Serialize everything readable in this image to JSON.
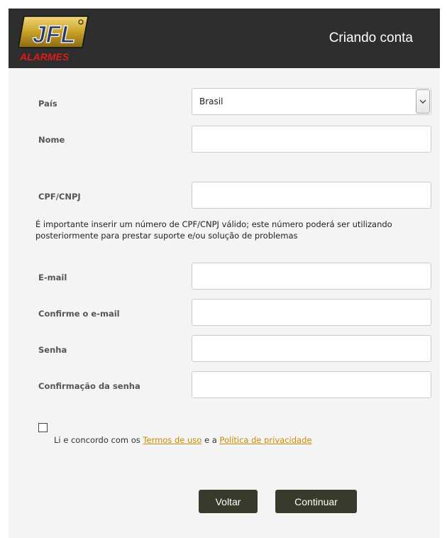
{
  "header": {
    "brand_top": "JFL",
    "brand_sub": "ALARMES",
    "title": "Criando conta"
  },
  "form": {
    "country": {
      "label": "País",
      "value": "Brasil"
    },
    "name": {
      "label": "Nome",
      "value": ""
    },
    "cpf": {
      "label": "CPF/CNPJ",
      "value": ""
    },
    "info": "É importante inserir um número de CPF/CNPJ válido; este número poderá ser utilizando posteriormente para prestar suporte e/ou solução de problemas",
    "email": {
      "label": "E-mail",
      "value": ""
    },
    "email_confirm": {
      "label": "Confirme o e-mail",
      "value": ""
    },
    "password": {
      "label": "Senha",
      "value": ""
    },
    "password_confirm": {
      "label": "Confirmação da senha",
      "value": ""
    }
  },
  "terms": {
    "checked": false,
    "prefix": "Li e concordo com os ",
    "terms_link": "Termos de uso",
    "middle": " e a ",
    "privacy_link": "Política de privacidade"
  },
  "buttons": {
    "back": "Voltar",
    "continue": "Continuar"
  },
  "colors": {
    "header_bg": "#2e2e2e",
    "panel_bg": "#f4f4f4",
    "button_bg": "#3a3a2c",
    "link": "#c98a00",
    "brand_red": "#e01b1b",
    "brand_gold": "#c9a227"
  }
}
